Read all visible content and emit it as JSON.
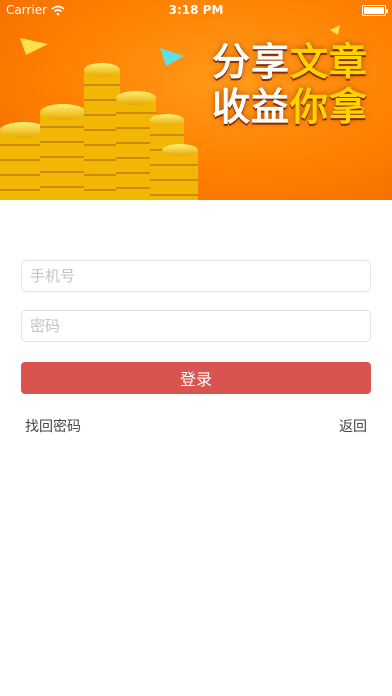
{
  "status_bar": {
    "carrier": "Carrier",
    "time": "3:18 PM",
    "battery_level": 1.0
  },
  "banner": {
    "line1_main": "分享",
    "line1_accent": "文章",
    "line2_main": "收益",
    "line2_accent": "你拿"
  },
  "form": {
    "phone_placeholder": "手机号",
    "password_placeholder": "密码",
    "login_label": "登录",
    "forgot_label": "找回密码",
    "back_label": "返回"
  },
  "colors": {
    "banner_orange": "#ff7f00",
    "coin_gold": "#ffd21a",
    "login_red": "#d9534f"
  }
}
